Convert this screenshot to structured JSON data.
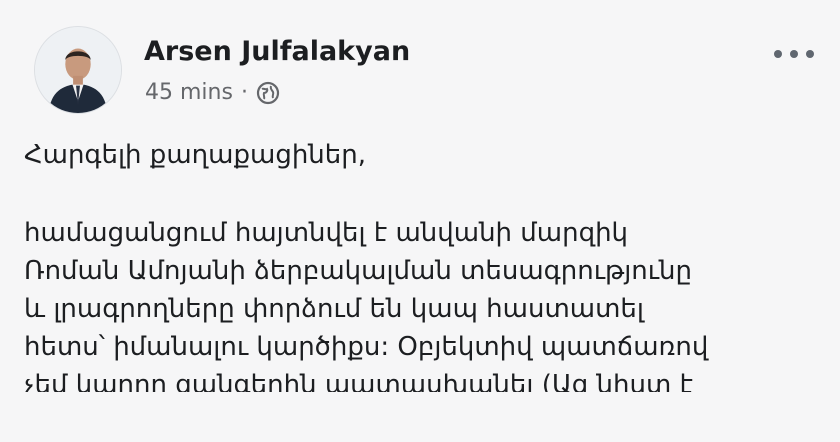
{
  "post": {
    "author": "Arsen Julfalakyan",
    "time": "45 mins",
    "separator": "·",
    "privacy_icon": "globe-icon",
    "more_icon": "more-options-icon",
    "greeting": "Հարգելի քաղաքացիներ,",
    "body_lines": [
      "համացանցում հայտնվել է անվանի մարզիկ",
      "Ռոման Ամոյանի ձերբակալման տեսագրությունը",
      "և լրագրողները փորձում են կապ հաստատել",
      "հետս՝ իմանալու կարծիքս: Օբյեկտիվ պատճառով",
      "չեմ կարող զանգերին պատասխանել (Ազ նիստ է"
    ]
  },
  "colors": {
    "text": "#1c1e21",
    "secondary": "#65676b"
  }
}
